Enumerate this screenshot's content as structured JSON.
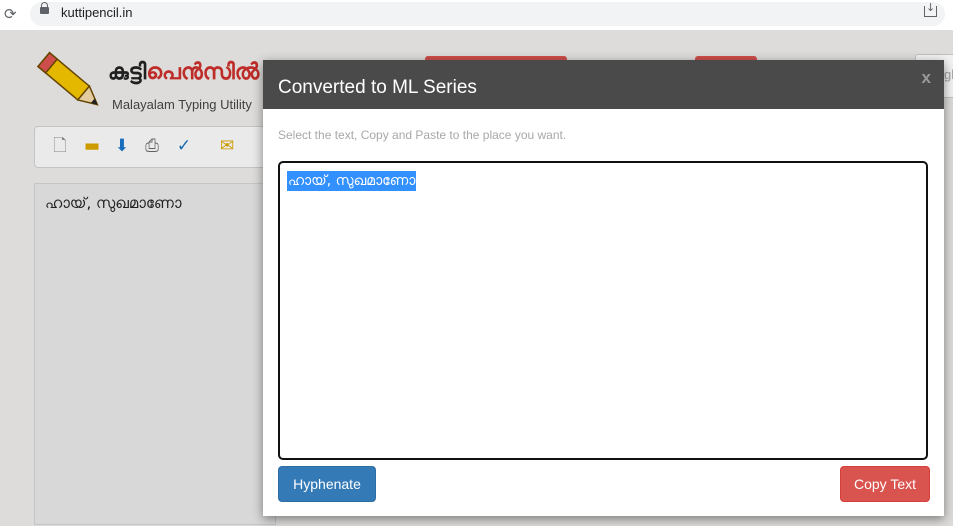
{
  "browser": {
    "url": "kuttipencil.in"
  },
  "page": {
    "logo_title_black": "കുട്ടി",
    "logo_title_red": "പെൻസിൽ",
    "logo_subtitle": "Malayalam Typing Utility",
    "search_partial": "gl",
    "editor_text": "ഹായ്, സുഖമാണോ"
  },
  "modal": {
    "title": "Converted to ML Series",
    "close_label": "x",
    "hint": "Select the text, Copy and Paste to the place you want.",
    "converted_text": "ഹായ്, സുഖമാണോ",
    "hyphenate_label": "Hyphenate",
    "copy_label": "Copy Text"
  },
  "colors": {
    "header_bg": "#4a4a4a",
    "primary_button": "#337ab7",
    "danger_button": "#d9534f",
    "selection": "#3390ff"
  },
  "icons": [
    "reload-icon",
    "lock-icon",
    "download-icon",
    "new-file-icon",
    "open-folder-icon",
    "save-download-icon",
    "print-icon",
    "spellcheck-icon",
    "email-icon",
    "close-icon"
  ]
}
